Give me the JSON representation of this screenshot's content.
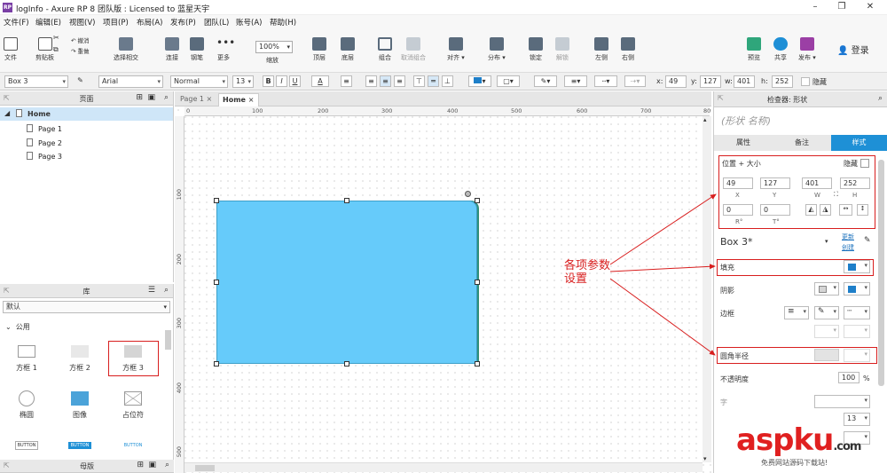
{
  "window": {
    "title": "logInfo - Axure RP 8 团队版 : Licensed to 蓝星天宇",
    "logo": "RP"
  },
  "menu": [
    "文件(F)",
    "编辑(E)",
    "视图(V)",
    "项目(P)",
    "布局(A)",
    "发布(P)",
    "团队(L)",
    "账号(A)",
    "帮助(H)"
  ],
  "toolbar": {
    "file": "文件",
    "clipboard": "剪贴板",
    "cut_icon": "scissors-icon",
    "copy_icon": "copy-icon",
    "undo": "撤消",
    "redo": "重做",
    "select_mode": "选择相交",
    "connect": "连接",
    "pen": "钢笔",
    "more": "更多",
    "zoom_value": "100%",
    "zoom_label": "缩放",
    "top": "顶层",
    "bottom": "底层",
    "group": "组合",
    "ungroup": "取消组合",
    "align": "对齐",
    "distribute": "分布",
    "lock": "锁定",
    "unlock": "解锁",
    "left": "左侧",
    "right": "右侧",
    "preview": "预览",
    "share": "共享",
    "publish": "发布",
    "login": "登录"
  },
  "format": {
    "widget": "Box 3",
    "font": "Arial",
    "style": "Normal",
    "size": "13",
    "x_label": "x:",
    "x": "49",
    "y_label": "y:",
    "y": "127",
    "w_label": "w:",
    "w": "401",
    "h_label": "h:",
    "h": "252",
    "hidden": "隐藏",
    "bold": "B",
    "italic": "I",
    "underline": "U",
    "text_color": "A"
  },
  "pages": {
    "title": "页面",
    "home": "Home",
    "children": [
      "Page 1",
      "Page 2",
      "Page 3"
    ]
  },
  "library": {
    "title": "库",
    "selected": "默认",
    "category": "公用",
    "items": [
      "方框 1",
      "方框 2",
      "方框 3",
      "椭圆",
      "图像",
      "占位符",
      "BUTTON",
      "BUTTON",
      "BUTTON"
    ],
    "masters": "母版"
  },
  "tabs": {
    "page1": "Page 1",
    "home": "Home"
  },
  "ruler_h": [
    "0",
    "100",
    "200",
    "300",
    "400",
    "500",
    "600",
    "700",
    "80"
  ],
  "ruler_v": [
    "100",
    "200",
    "300",
    "400",
    "500"
  ],
  "inspector": {
    "title": "检查器: 形状",
    "shape_name": "(形状 名称)",
    "tabs": [
      "属性",
      "备注",
      "样式"
    ],
    "pos_size": "位置 + 大小",
    "hidden": "隐藏",
    "x": "49",
    "y": "127",
    "w": "401",
    "h": "252",
    "x_lbl": "X",
    "y_lbl": "Y",
    "w_lbl": "W",
    "h_lbl": "H",
    "r": "0",
    "t": "0",
    "r_lbl": "R°",
    "t_lbl": "T°",
    "style_name": "Box 3*",
    "update": "更新",
    "create": "创建",
    "fill": "填充",
    "shadow": "阴影",
    "border": "边框",
    "corner": "圆角半径",
    "opacity": "不透明度",
    "opacity_val": "100",
    "opacity_unit": "%",
    "font": "字",
    "font_size": "13"
  },
  "annotation": {
    "line1": "各项参数",
    "line2": "设置"
  },
  "watermark": {
    "brand": "aspku",
    "tld": ".com",
    "sub": "免费网站源码下载站!"
  },
  "colors": {
    "accent": "#1e90d6",
    "shape_fill": "#66cbfa",
    "annotation": "#d81e1e"
  }
}
